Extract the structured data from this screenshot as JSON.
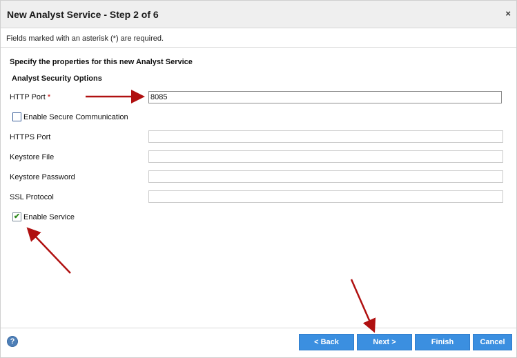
{
  "dialog": {
    "title": "New Analyst Service - Step 2 of 6",
    "close_glyph": "×",
    "required_note": "Fields marked with an asterisk (*) are required.",
    "heading": "Specify the properties for this new Analyst Service",
    "section_title": "Analyst Security Options"
  },
  "form": {
    "http_port": {
      "label": "HTTP Port",
      "required_mark": "*",
      "value": "8085"
    },
    "secure_comm": {
      "label": "Enable Secure Communication",
      "checked": false
    },
    "https_port": {
      "label": "HTTPS Port",
      "value": ""
    },
    "keystore_file": {
      "label": "Keystore File",
      "value": ""
    },
    "keystore_password": {
      "label": "Keystore Password",
      "value": ""
    },
    "ssl_protocol": {
      "label": "SSL Protocol",
      "value": ""
    },
    "enable_service": {
      "label": "Enable Service",
      "checked": true,
      "check_glyph": "✔"
    }
  },
  "footer": {
    "help_glyph": "?",
    "back_label": "< Back",
    "next_label": "Next >",
    "finish_label": "Finish",
    "cancel_label": "Cancel"
  },
  "colors": {
    "button_blue": "#3b8fe0",
    "annotation_red": "#b01010",
    "required_red": "#c00000",
    "check_green": "#2f8a1c"
  },
  "icons": {
    "close": "close-icon",
    "help": "help-icon",
    "check": "check-icon"
  }
}
